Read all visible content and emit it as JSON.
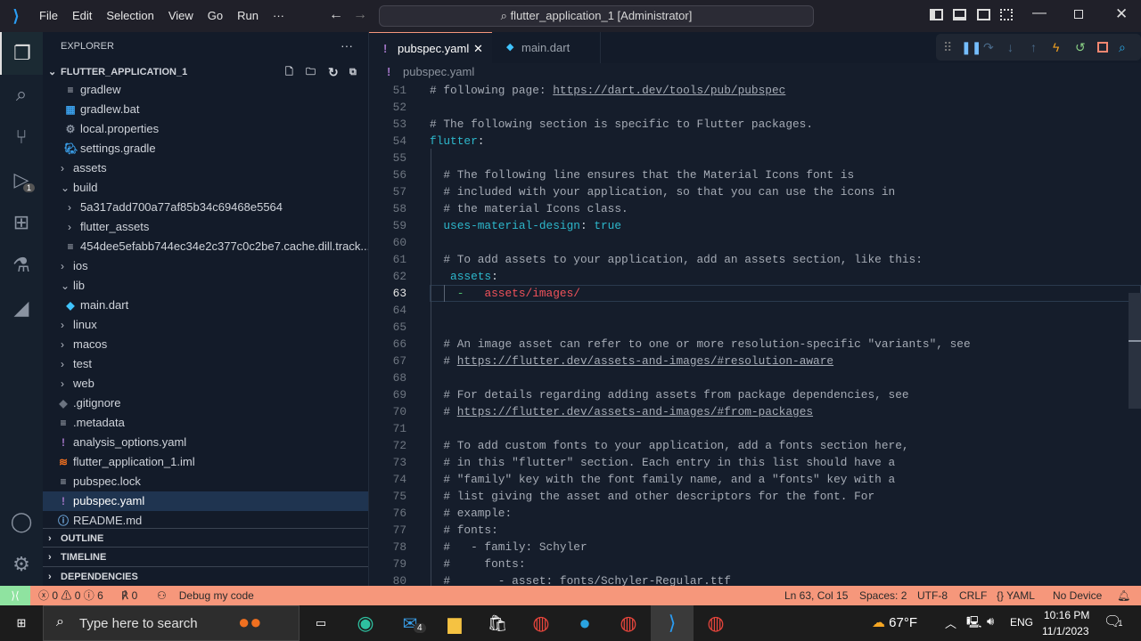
{
  "titlebar": {
    "menus": [
      "File",
      "Edit",
      "Selection",
      "View",
      "Go",
      "Run",
      "···"
    ],
    "command_center": "flutter_application_1 [Administrator]"
  },
  "activity": {
    "run_badge": "1"
  },
  "sidebar": {
    "title": "EXPLORER",
    "more": "···",
    "root": "FLUTTER_APPLICATION_1",
    "items": [
      {
        "label": "gradlew",
        "kind": "file",
        "icon": "lines-icon",
        "depth": 2
      },
      {
        "label": "gradlew.bat",
        "kind": "file",
        "icon": "windows-icon",
        "depth": 2
      },
      {
        "label": "local.properties",
        "kind": "file",
        "icon": "gear-icon",
        "depth": 2
      },
      {
        "label": "settings.gradle",
        "kind": "file",
        "icon": "gradle-elephant-icon",
        "depth": 2
      },
      {
        "label": "assets",
        "kind": "folder-closed",
        "depth": 1
      },
      {
        "label": "build",
        "kind": "folder-open",
        "depth": 1
      },
      {
        "label": "5a317add700a77af85b34c69468e5564",
        "kind": "folder-closed",
        "depth": 2
      },
      {
        "label": "flutter_assets",
        "kind": "folder-closed",
        "depth": 2
      },
      {
        "label": "454dee5efabb744ec34e2c377c0c2be7.cache.dill.track....",
        "kind": "file",
        "icon": "lines-icon",
        "depth": 2
      },
      {
        "label": "ios",
        "kind": "folder-closed",
        "depth": 1
      },
      {
        "label": "lib",
        "kind": "folder-open",
        "depth": 1
      },
      {
        "label": "main.dart",
        "kind": "file",
        "icon": "dart-icon",
        "depth": 2
      },
      {
        "label": "linux",
        "kind": "folder-closed",
        "depth": 1
      },
      {
        "label": "macos",
        "kind": "folder-closed",
        "depth": 1
      },
      {
        "label": "test",
        "kind": "folder-closed",
        "depth": 1
      },
      {
        "label": "web",
        "kind": "folder-closed",
        "depth": 1
      },
      {
        "label": ".gitignore",
        "kind": "file",
        "icon": "git-icon",
        "depth": 1
      },
      {
        "label": ".metadata",
        "kind": "file",
        "icon": "lines-icon",
        "depth": 1
      },
      {
        "label": "analysis_options.yaml",
        "kind": "file",
        "icon": "yaml-icon",
        "depth": 1
      },
      {
        "label": "flutter_application_1.iml",
        "kind": "file",
        "icon": "rss-icon",
        "depth": 1
      },
      {
        "label": "pubspec.lock",
        "kind": "file",
        "icon": "lines-icon",
        "depth": 1
      },
      {
        "label": "pubspec.yaml",
        "kind": "file",
        "icon": "yaml-icon",
        "depth": 1,
        "selected": true
      },
      {
        "label": "README.md",
        "kind": "file",
        "icon": "info-icon",
        "depth": 1
      }
    ],
    "sections": [
      "OUTLINE",
      "TIMELINE",
      "DEPENDENCIES"
    ]
  },
  "tabs": [
    {
      "label": "pubspec.yaml",
      "active": true,
      "icon": "yaml-icon"
    },
    {
      "label": "main.dart",
      "active": false,
      "icon": "dart-icon"
    }
  ],
  "breadcrumb": "pubspec.yaml",
  "editor": {
    "current_line": 63,
    "lines": [
      {
        "n": 51,
        "t": [
          [
            "# following page: ",
            "comment"
          ],
          [
            "https://dart.dev/tools/pub/pubspec",
            "link"
          ]
        ]
      },
      {
        "n": 52,
        "t": []
      },
      {
        "n": 53,
        "t": [
          [
            "# The following section is specific to Flutter packages.",
            "comment"
          ]
        ]
      },
      {
        "n": 54,
        "t": [
          [
            "flutter",
            "key"
          ],
          [
            ":",
            "punct"
          ]
        ]
      },
      {
        "n": 55,
        "t": []
      },
      {
        "n": 56,
        "t": [
          [
            "  # The following line ensures that the Material Icons font is",
            "comment"
          ]
        ]
      },
      {
        "n": 57,
        "t": [
          [
            "  # included with your application, so that you can use the icons in",
            "comment"
          ]
        ]
      },
      {
        "n": 58,
        "t": [
          [
            "  # the material Icons class.",
            "comment"
          ]
        ]
      },
      {
        "n": 59,
        "t": [
          [
            "  uses-material-design",
            "key"
          ],
          [
            ": ",
            "punct"
          ],
          [
            "true",
            "bool"
          ]
        ]
      },
      {
        "n": 60,
        "t": []
      },
      {
        "n": 61,
        "t": [
          [
            "  # To add assets to your application, add an assets section, like this:",
            "comment"
          ]
        ]
      },
      {
        "n": 62,
        "t": [
          [
            "   assets",
            "key"
          ],
          [
            ":",
            "punct"
          ]
        ]
      },
      {
        "n": 63,
        "t": [
          [
            "    -",
            "dash"
          ],
          [
            "   assets/images/",
            "str"
          ]
        ]
      },
      {
        "n": 64,
        "t": []
      },
      {
        "n": 65,
        "t": []
      },
      {
        "n": 66,
        "t": [
          [
            "  # An image asset can refer to one or more resolution-specific \"variants\", see",
            "comment"
          ]
        ]
      },
      {
        "n": 67,
        "t": [
          [
            "  # ",
            "comment"
          ],
          [
            "https://flutter.dev/assets-and-images/#resolution-aware",
            "link"
          ]
        ]
      },
      {
        "n": 68,
        "t": []
      },
      {
        "n": 69,
        "t": [
          [
            "  # For details regarding adding assets from package dependencies, see",
            "comment"
          ]
        ]
      },
      {
        "n": 70,
        "t": [
          [
            "  # ",
            "comment"
          ],
          [
            "https://flutter.dev/assets-and-images/#from-packages",
            "link"
          ]
        ]
      },
      {
        "n": 71,
        "t": []
      },
      {
        "n": 72,
        "t": [
          [
            "  # To add custom fonts to your application, add a fonts section here,",
            "comment"
          ]
        ]
      },
      {
        "n": 73,
        "t": [
          [
            "  # in this \"flutter\" section. Each entry in this list should have a",
            "comment"
          ]
        ]
      },
      {
        "n": 74,
        "t": [
          [
            "  # \"family\" key with the font family name, and a \"fonts\" key with a",
            "comment"
          ]
        ]
      },
      {
        "n": 75,
        "t": [
          [
            "  # list giving the asset and other descriptors for the font. For",
            "comment"
          ]
        ]
      },
      {
        "n": 76,
        "t": [
          [
            "  # example:",
            "comment"
          ]
        ]
      },
      {
        "n": 77,
        "t": [
          [
            "  # fonts:",
            "comment"
          ]
        ]
      },
      {
        "n": 78,
        "t": [
          [
            "  #   - family: Schyler",
            "comment"
          ]
        ]
      },
      {
        "n": 79,
        "t": [
          [
            "  #     fonts:",
            "comment"
          ]
        ]
      },
      {
        "n": 80,
        "t": [
          [
            "  #       - asset: fonts/Schyler-Regular.ttf",
            "comment"
          ]
        ]
      }
    ]
  },
  "status": {
    "errors": "0",
    "warnings": "0",
    "infos": "6",
    "ports": "0",
    "debug": "Debug my code",
    "position": "Ln 63, Col 15",
    "spaces": "Spaces: 2",
    "encoding": "UTF-8",
    "eol": "CRLF",
    "language": "YAML",
    "device": "No Device",
    "colors": {
      "bar": "#f6977b",
      "remote": "#8fe3a0"
    }
  },
  "taskbar": {
    "search_placeholder": "Type here to search",
    "mail_badge": "4",
    "weather": "67°F",
    "lang": "ENG",
    "time": "10:16 PM",
    "date": "11/1/2023",
    "notif_badge": "1"
  }
}
